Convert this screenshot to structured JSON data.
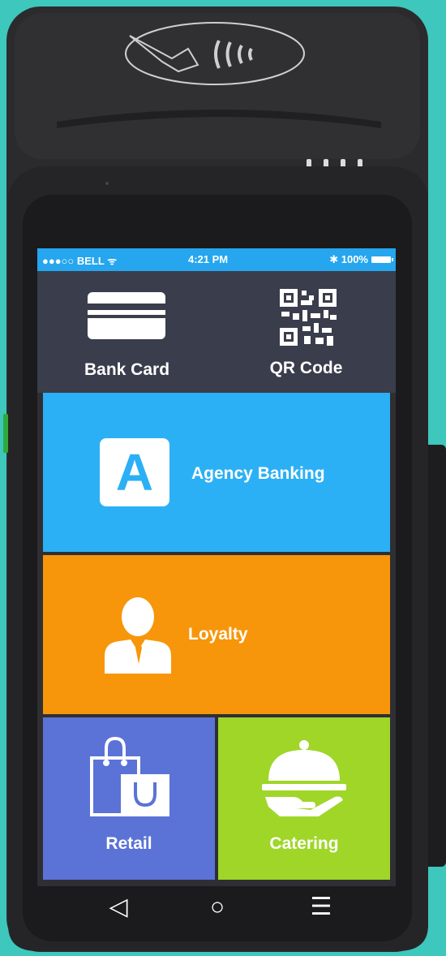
{
  "status_bar": {
    "carrier": "●●●○○ BELL ᯤ",
    "time": "4:21 PM",
    "battery": "✱ 100%"
  },
  "tiles": {
    "bank_card": {
      "label": "Bank Card",
      "icon": "card-icon"
    },
    "qr_code": {
      "label": "QR Code",
      "icon": "qr-code-icon"
    },
    "agency_banking": {
      "label": "Agency Banking",
      "icon_letter": "A",
      "color": "#2cb0f5"
    },
    "loyalty": {
      "label": "Loyalty",
      "icon": "person-icon",
      "color": "#f7960a"
    },
    "retail": {
      "label": "Retail",
      "icon": "shopping-bag-icon",
      "color": "#5b73d6"
    },
    "catering": {
      "label": "Catering",
      "icon": "cloche-icon",
      "color": "#9fd628"
    }
  },
  "nav": {
    "back": "◁",
    "home": "○",
    "menu": "☰"
  },
  "colors": {
    "background": "#3ec7bd",
    "device": "#2b2b2e",
    "status_bar": "#25a6ee"
  }
}
